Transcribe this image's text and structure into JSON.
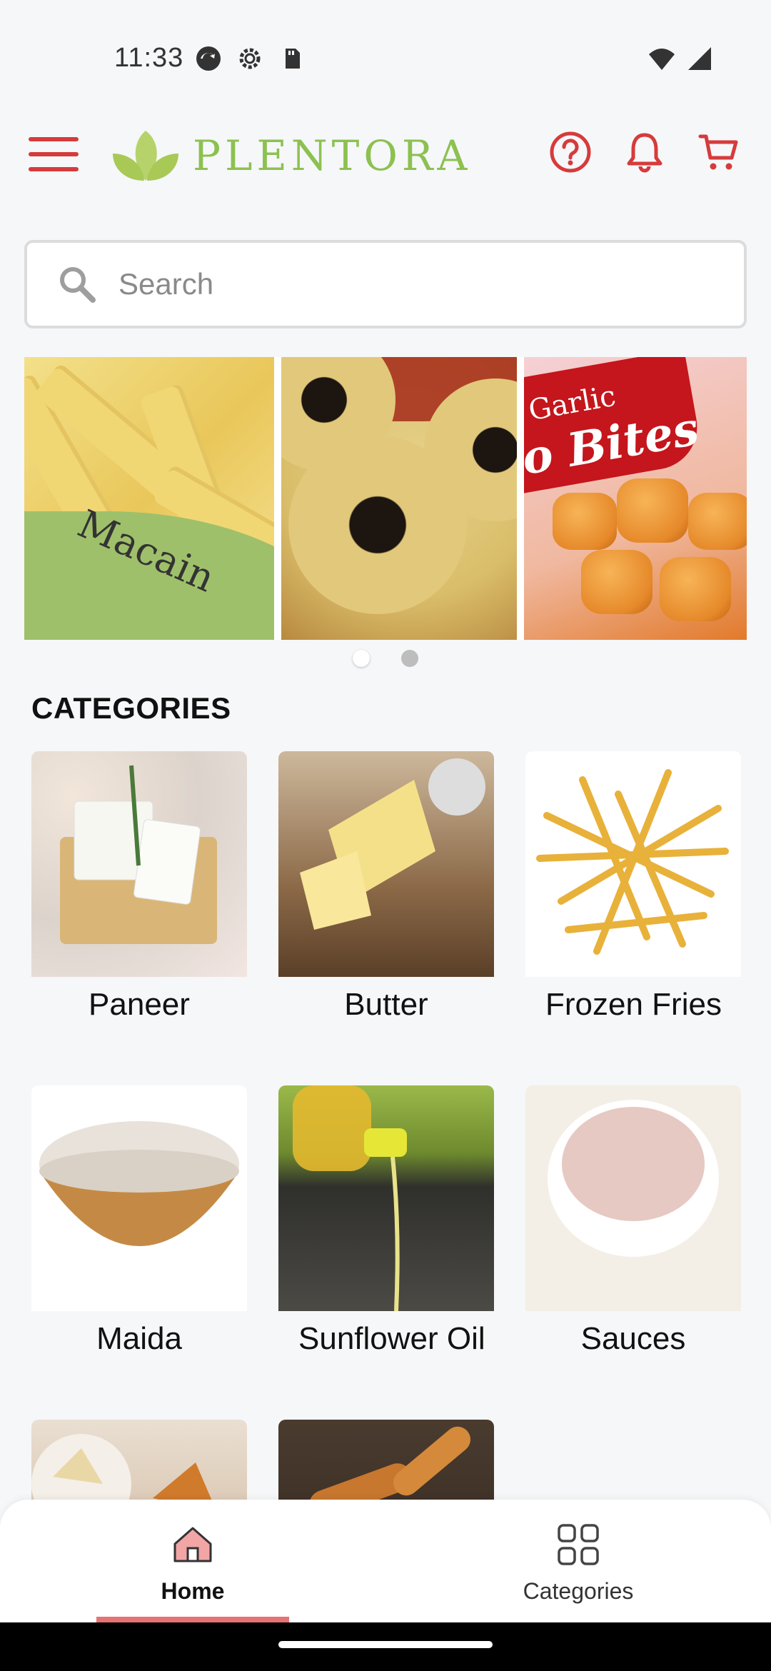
{
  "status_bar": {
    "time": "11:33",
    "icons_left": [
      "sync-icon",
      "settings-icon",
      "sd-card-icon"
    ],
    "icons_right": [
      "wifi-icon",
      "signal-icon"
    ]
  },
  "header": {
    "brand": "PLENTORA",
    "brand_color": "#8cc150",
    "accent_color": "#d63b3b",
    "icons": [
      "menu-icon",
      "help-icon",
      "bell-icon",
      "cart-icon"
    ]
  },
  "search": {
    "placeholder": "Search",
    "value": ""
  },
  "banner": {
    "panel_texts": {
      "brand": "Macain",
      "product_line1": "Garlic",
      "product_line2": "o Bites"
    },
    "dots_total": 2,
    "active_dot": 1
  },
  "categories": {
    "title": "CATEGORIES",
    "items": [
      {
        "label": "Paneer"
      },
      {
        "label": "Butter"
      },
      {
        "label": "Frozen Fries"
      },
      {
        "label": "Maida"
      },
      {
        "label": "Sunflower Oil"
      },
      {
        "label": "Sauces"
      },
      {
        "label": ""
      },
      {
        "label": ""
      }
    ]
  },
  "bottom_nav": {
    "items": [
      {
        "label": "Home",
        "icon": "home-icon",
        "active": true
      },
      {
        "label": "Categories",
        "icon": "grid-icon",
        "active": false
      }
    ],
    "active_color": "#e57373"
  }
}
